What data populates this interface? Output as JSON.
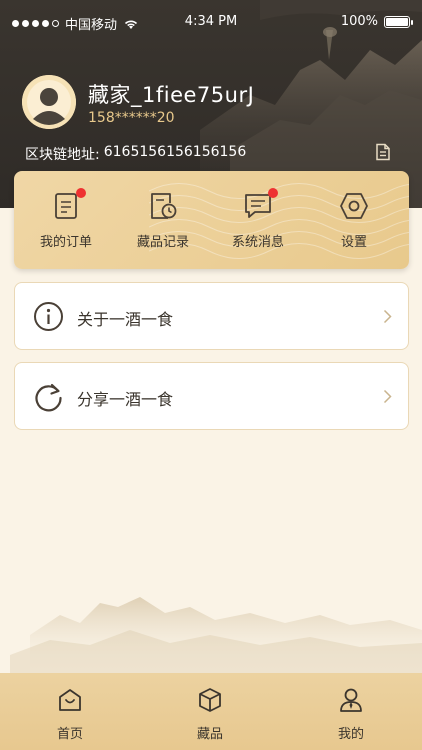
{
  "status_bar": {
    "carrier": "中国移动",
    "time": "4:34 PM",
    "battery": "100%",
    "signal_icon": "signal-dots-icon",
    "wifi_icon": "wifi-icon",
    "battery_icon": "battery-icon"
  },
  "profile": {
    "username": "藏家_1fiee75urJ",
    "phone": "158******20",
    "chain_label": "区块链地址:",
    "chain_address": "6165156156156156",
    "avatar_icon": "user-avatar-icon",
    "copy_icon": "document-icon"
  },
  "quick_actions": [
    {
      "label": "我的订单",
      "icon": "order-document-icon",
      "badge": true
    },
    {
      "label": "藏品记录",
      "icon": "record-clock-icon",
      "badge": false
    },
    {
      "label": "系统消息",
      "icon": "message-icon",
      "badge": true
    },
    {
      "label": "设置",
      "icon": "settings-hex-icon",
      "badge": false
    }
  ],
  "menu": [
    {
      "label": "关于一酒一食",
      "icon": "info-icon"
    },
    {
      "label": "分享一酒一食",
      "icon": "share-icon"
    }
  ],
  "tabs": [
    {
      "label": "首页",
      "icon": "home-bag-icon",
      "active": false
    },
    {
      "label": "藏品",
      "icon": "box-icon",
      "active": false
    },
    {
      "label": "我的",
      "icon": "profile-icon",
      "active": true
    }
  ],
  "colors": {
    "header_bg": "#312d29",
    "accent_gold": "#e8c98c",
    "badge_red": "#ee3131",
    "page_bg": "#faf3e6"
  }
}
